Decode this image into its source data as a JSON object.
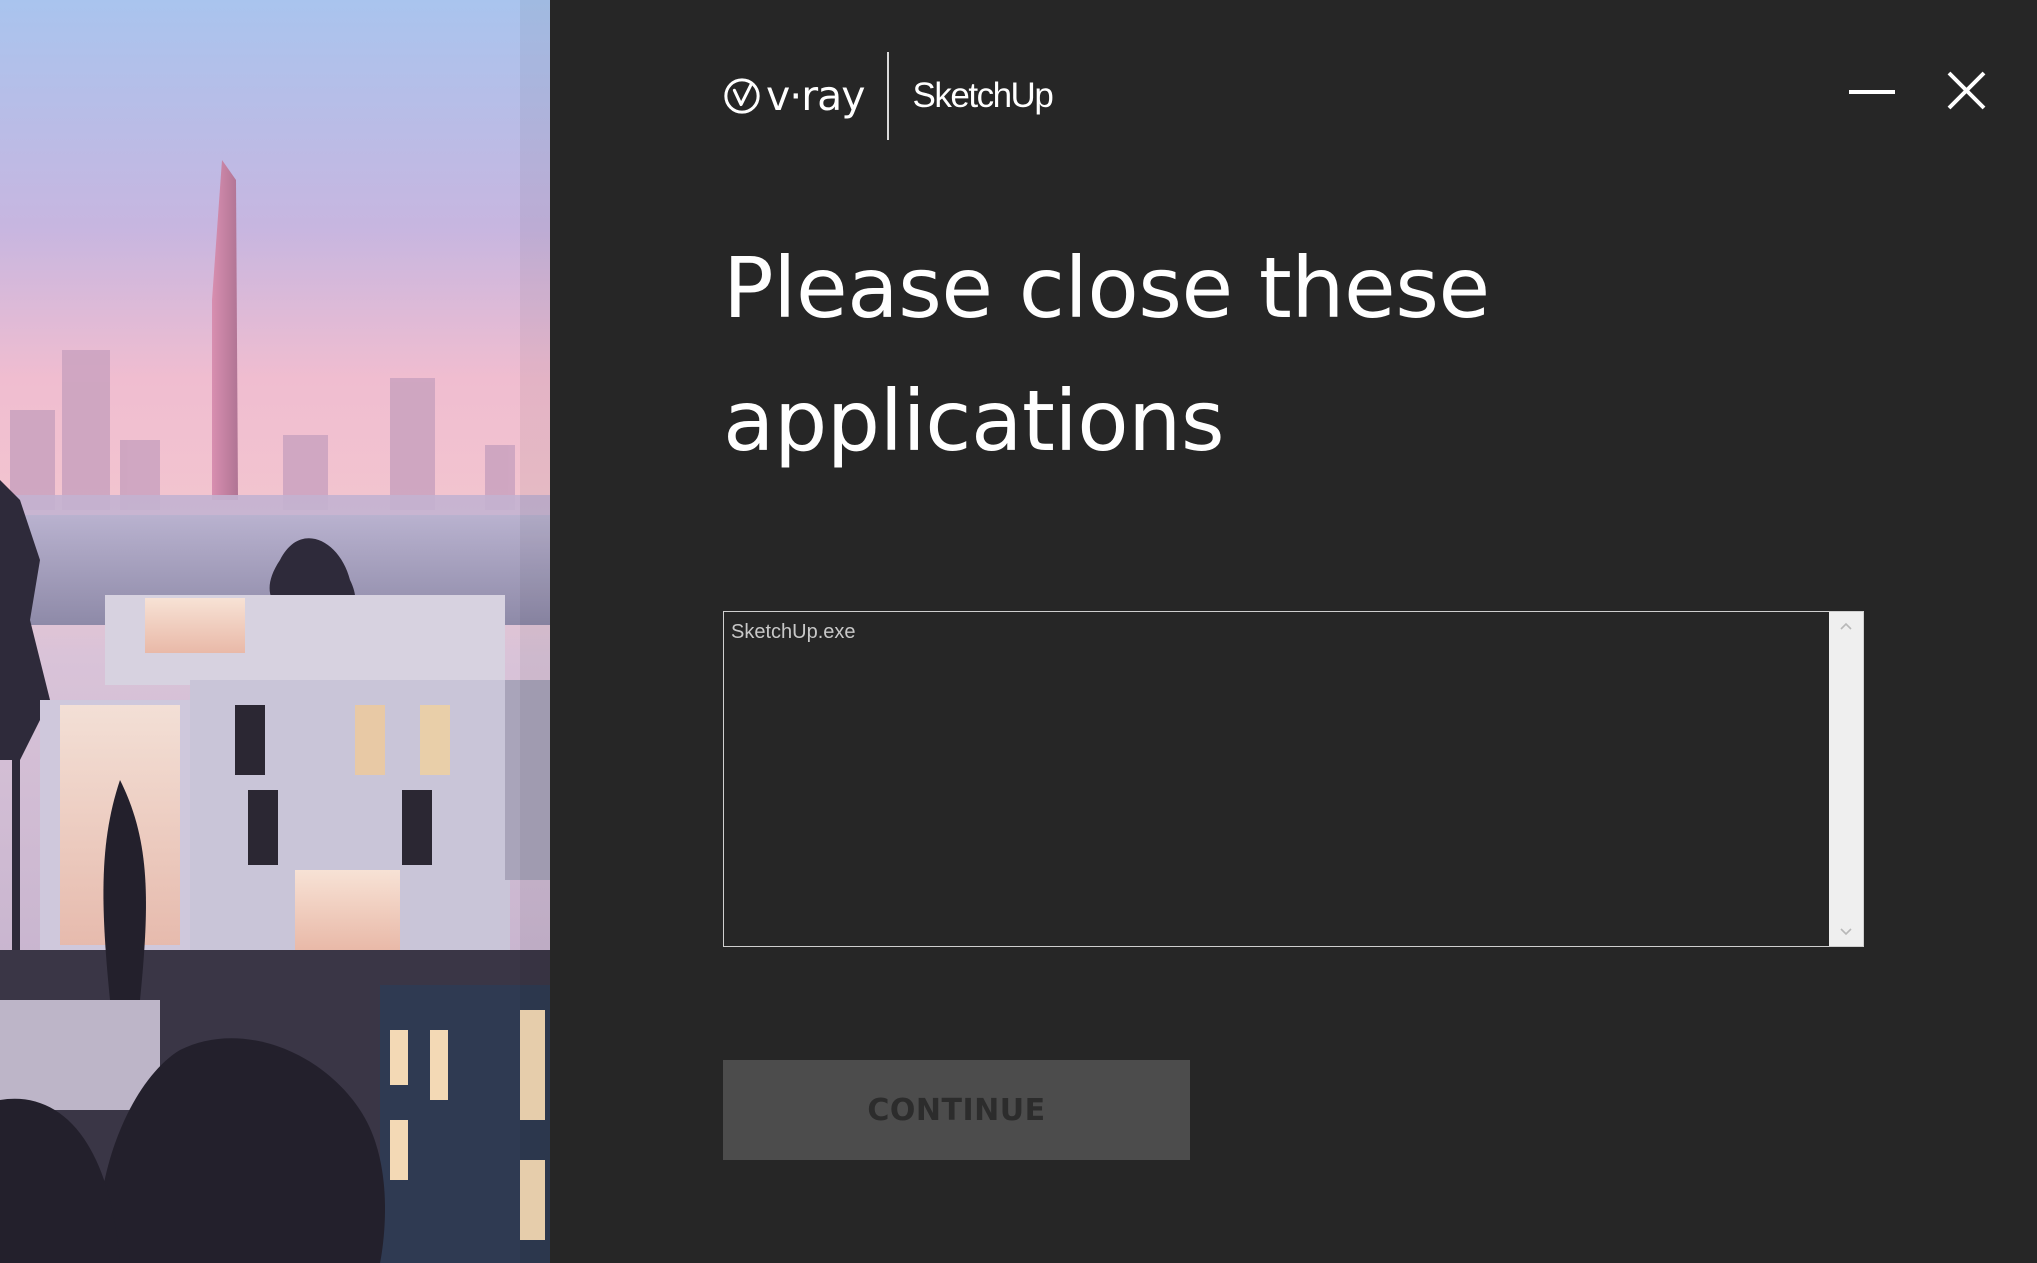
{
  "window": {
    "title": "Please close these applications",
    "accent_color": "#262626"
  },
  "brand": {
    "vray_logo_text": "v·ray",
    "vray_icon": "vray-checkmark-icon",
    "sketchup_logo_text": "SketchUp"
  },
  "controls": {
    "minimize_icon": "minimize-icon",
    "close_icon": "close-icon"
  },
  "main": {
    "heading_line1": "Please close these",
    "heading_line2": "applications",
    "applications": [
      "SketchUp.exe"
    ],
    "continue_label": "CONTINUE",
    "continue_enabled": false
  },
  "hero": {
    "image": "architectural-rendering-illustration"
  }
}
